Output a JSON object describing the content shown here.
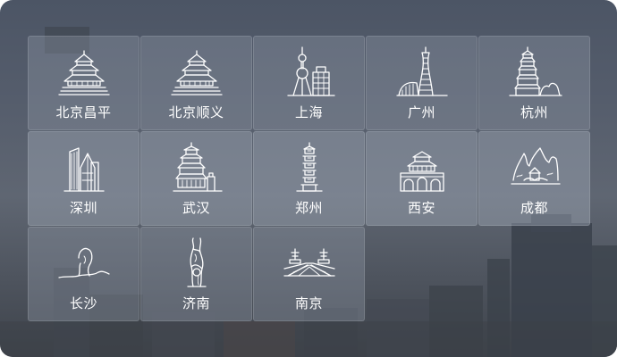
{
  "cities": [
    {
      "label": "北京昌平",
      "icon": "temple-of-heaven-icon"
    },
    {
      "label": "北京顺义",
      "icon": "temple-of-heaven-icon"
    },
    {
      "label": "上海",
      "icon": "oriental-pearl-tower-icon"
    },
    {
      "label": "广州",
      "icon": "canton-tower-icon"
    },
    {
      "label": "杭州",
      "icon": "leifeng-pagoda-icon"
    },
    {
      "label": "深圳",
      "icon": "skyscrapers-icon"
    },
    {
      "label": "武汉",
      "icon": "yellow-crane-tower-icon"
    },
    {
      "label": "郑州",
      "icon": "erqi-tower-icon"
    },
    {
      "label": "西安",
      "icon": "city-gate-icon"
    },
    {
      "label": "成都",
      "icon": "mountain-pavilion-icon"
    },
    {
      "label": "长沙",
      "icon": "mao-statue-icon"
    },
    {
      "label": "济南",
      "icon": "quancheng-monument-icon"
    },
    {
      "label": "南京",
      "icon": "yangtze-bridge-icon"
    }
  ],
  "colors": {
    "tile_bg": "rgba(150,158,172,0.34)",
    "label": "#ffffff"
  }
}
